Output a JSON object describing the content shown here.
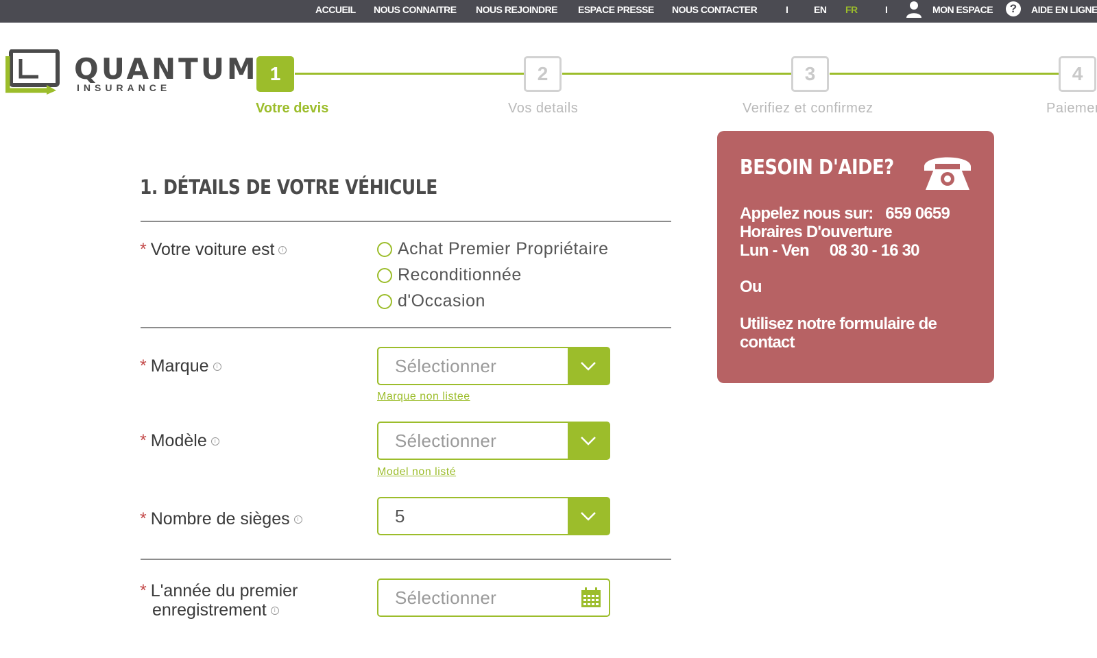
{
  "nav": {
    "accueil": "ACCUEIL",
    "about": "NOUS CONNAITRE",
    "join": "NOUS REJOINDRE",
    "press": "ESPACE PRESSE",
    "contact": "NOUS CONTACTER",
    "sep1": "I",
    "lang_en": "EN",
    "lang_fr": "FR",
    "sep2": "I",
    "my_space": "MON ESPACE",
    "help_glyph": "?",
    "help_online": "AIDE EN LIGNE",
    "user_icon": "user-icon",
    "help_icon": "question-circle-icon"
  },
  "logo": {
    "title": "QUANTUM",
    "subtitle": "INSURANCE"
  },
  "steps": [
    {
      "num": "1",
      "label": "Votre devis",
      "active": true
    },
    {
      "num": "2",
      "label": "Vos details",
      "active": false
    },
    {
      "num": "3",
      "label": "Verifiez et confirmez",
      "active": false
    },
    {
      "num": "4",
      "label": "Paiemen",
      "active": false
    }
  ],
  "section": {
    "title": "1. DÉTAILS DE VOTRE VÉHICULE"
  },
  "form": {
    "required_mark": "*",
    "info_glyph": "i",
    "car_status": {
      "label": "Votre voiture est",
      "options": [
        "Achat Premier Propriétaire",
        "Reconditionnée",
        "d'Occasion"
      ]
    },
    "brand": {
      "label": "Marque",
      "value": "Sélectionner",
      "link": "Marque non listee"
    },
    "model": {
      "label": "Modèle",
      "value": "Sélectionner",
      "link": "Model non listé"
    },
    "seats": {
      "label": "Nombre de sièges",
      "value": "5"
    },
    "reg_year": {
      "label_line1": "L'année du premier",
      "label_line2": "enregistrement",
      "value": "Sélectionner"
    }
  },
  "help": {
    "title": "BESOIN D'AIDE?",
    "call_label": "Appelez nous sur:",
    "phone_number": "659 0659",
    "hours_label": "Horaires D'ouverture",
    "days": "Lun - Ven",
    "hours": "08 30 - 16 30",
    "or": "Ou",
    "form_line1": "Utilisez notre  formulaire  de",
    "form_line2": "contact"
  },
  "colors": {
    "accent": "#9cbd2b",
    "nav_bg": "#4b4b52",
    "help_bg": "#b76264",
    "required": "#c44a4a"
  }
}
